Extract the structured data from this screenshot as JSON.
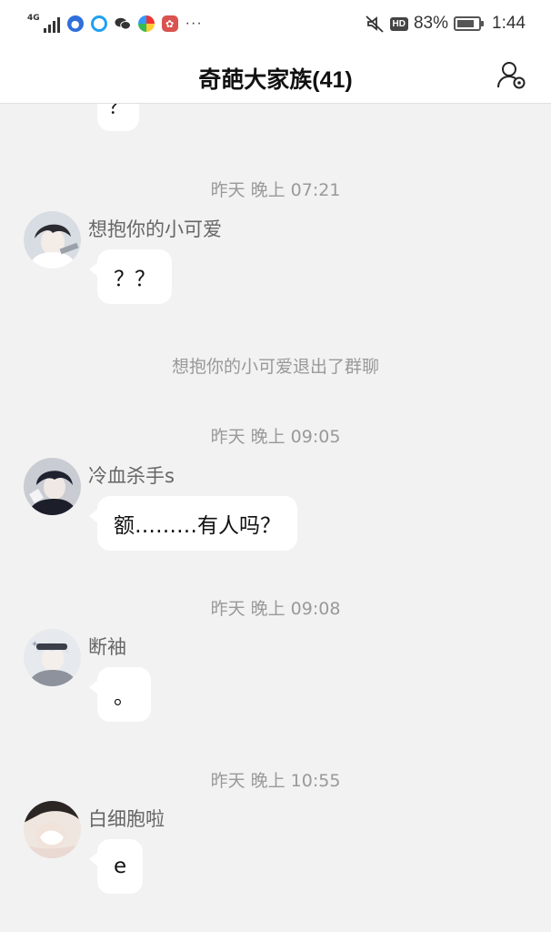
{
  "status_bar": {
    "network": "4G",
    "battery_percent": "83%",
    "battery_level": 0.83,
    "hd_label": "HD",
    "time": "1:44",
    "more": "···"
  },
  "header": {
    "title": "奇葩大家族(41)"
  },
  "chat": {
    "top_partial_bubble": "？",
    "entries": [
      {
        "type": "time",
        "text": "昨天 晚上 07:21"
      },
      {
        "type": "message",
        "sender": "想抱你的小可爱",
        "text": "？？"
      },
      {
        "type": "system",
        "text": "想抱你的小可爱退出了群聊"
      },
      {
        "type": "time",
        "text": "昨天 晚上 09:05"
      },
      {
        "type": "message",
        "sender": "冷血杀手s",
        "text": "额………有人吗？"
      },
      {
        "type": "time",
        "text": "昨天 晚上 09:08"
      },
      {
        "type": "message",
        "sender": "断袖",
        "text": "。"
      },
      {
        "type": "time",
        "text": "昨天 晚上 10:55"
      },
      {
        "type": "message",
        "sender": "白细胞啦",
        "text": "e"
      }
    ]
  },
  "colors": {
    "background": "#f2f2f2",
    "bubble": "#ffffff",
    "meta_text": "#999999"
  }
}
